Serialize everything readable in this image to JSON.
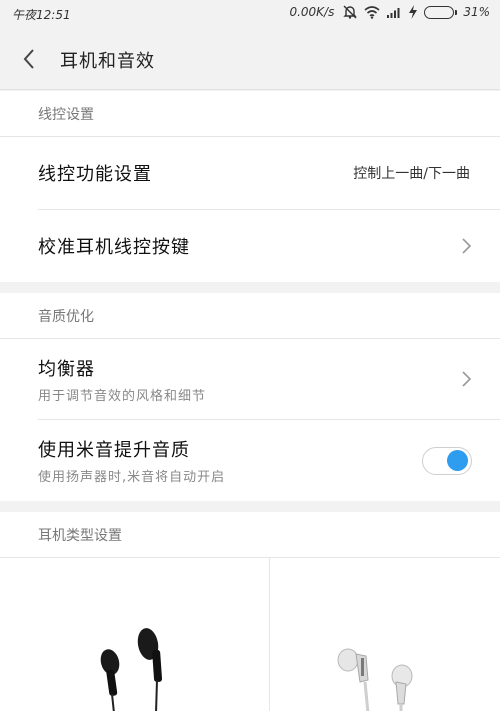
{
  "status_bar": {
    "time": "午夜12:51",
    "network_speed": "0.00K/s",
    "battery_percent": "31%",
    "battery_level": 0.31,
    "battery_color": "#2bb24c"
  },
  "header": {
    "title": "耳机和音效",
    "back_icon": "chevron-left-icon"
  },
  "sections": {
    "wire_control": {
      "header": "线控设置",
      "items": [
        {
          "title": "线控功能设置",
          "value": "控制上一曲/下一曲"
        },
        {
          "title": "校准耳机线控按键"
        }
      ]
    },
    "sound_quality": {
      "header": "音质优化",
      "items": [
        {
          "title": "均衡器",
          "subtitle": "用于调节音效的风格和细节"
        },
        {
          "title": "使用米音提升音质",
          "subtitle": "使用扬声器时,米音将自动开启",
          "toggle_on": true
        }
      ]
    },
    "earphone_type": {
      "header": "耳机类型设置",
      "options": [
        "black-earbuds-icon",
        "white-in-ear-earphones-icon"
      ]
    }
  },
  "colors": {
    "accent": "#2e9df0",
    "background": "#f2f2f2"
  }
}
